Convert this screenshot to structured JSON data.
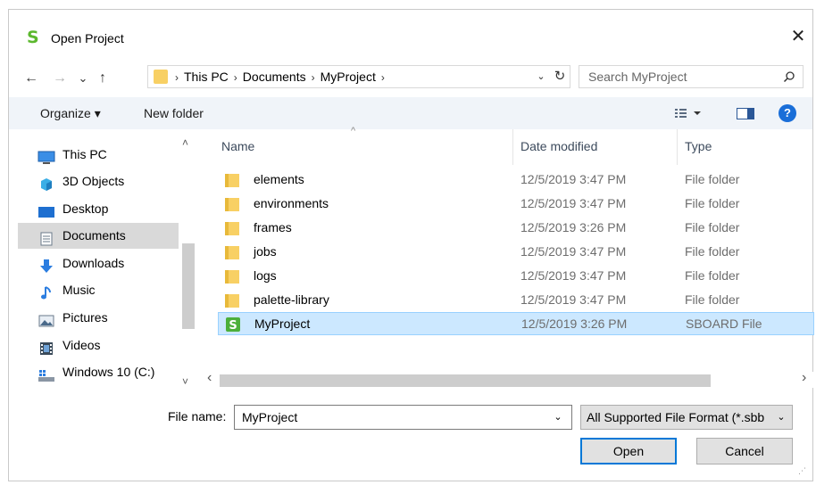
{
  "window": {
    "title": "Open Project",
    "close_glyph": "✕"
  },
  "nav_buttons": {
    "back": "←",
    "forward": "→",
    "recent": "⌄",
    "up": "↑"
  },
  "address": {
    "breadcrumbs": [
      "This PC",
      "Documents",
      "MyProject"
    ],
    "separator": "›",
    "dropdown_glyph": "⌄",
    "refresh_glyph": "↻"
  },
  "search": {
    "placeholder": "Search MyProject",
    "icon_glyph": "⚲"
  },
  "toolbar": {
    "organize_label": "Organize ▾",
    "new_folder_label": "New folder",
    "help_label": "?"
  },
  "nav_pane": {
    "items": [
      {
        "label": "This PC",
        "icon": "computer-icon"
      },
      {
        "label": "3D Objects",
        "icon": "3d-objects-icon"
      },
      {
        "label": "Desktop",
        "icon": "desktop-icon"
      },
      {
        "label": "Documents",
        "icon": "documents-icon",
        "selected": true
      },
      {
        "label": "Downloads",
        "icon": "download-arrow-icon"
      },
      {
        "label": "Music",
        "icon": "music-note-icon"
      },
      {
        "label": "Pictures",
        "icon": "pictures-icon"
      },
      {
        "label": "Videos",
        "icon": "film-icon"
      },
      {
        "label": "Windows 10 (C:)",
        "icon": "drive-icon"
      }
    ]
  },
  "columns": {
    "name": "Name",
    "date": "Date modified",
    "type": "Type"
  },
  "files": [
    {
      "name": "elements",
      "date": "12/5/2019 3:47 PM",
      "type": "File folder",
      "icon": "folder-icon"
    },
    {
      "name": "environments",
      "date": "12/5/2019 3:47 PM",
      "type": "File folder",
      "icon": "folder-icon"
    },
    {
      "name": "frames",
      "date": "12/5/2019 3:26 PM",
      "type": "File folder",
      "icon": "folder-icon"
    },
    {
      "name": "jobs",
      "date": "12/5/2019 3:47 PM",
      "type": "File folder",
      "icon": "folder-icon"
    },
    {
      "name": "logs",
      "date": "12/5/2019 3:47 PM",
      "type": "File folder",
      "icon": "folder-icon"
    },
    {
      "name": "palette-library",
      "date": "12/5/2019 3:47 PM",
      "type": "File folder",
      "icon": "folder-icon"
    },
    {
      "name": "MyProject",
      "date": "12/5/2019 3:26 PM",
      "type": "SBOARD File",
      "icon": "sboard-file-icon",
      "selected": true
    }
  ],
  "scroll": {
    "left_arrow": "‹",
    "right_arrow": "›",
    "up_arrow": "˄",
    "down_arrow": "˅"
  },
  "bottom": {
    "file_name_label": "File name:",
    "file_name_value": "MyProject",
    "filter_value": "All Supported File Format (*.sbb",
    "open_label": "Open",
    "cancel_label": "Cancel",
    "dropdown_glyph": "⌄"
  },
  "colors": {
    "toolbar_bg": "#f0f4f9",
    "selection_bg": "#cce8ff",
    "folder_yellow": "#f8d064",
    "accent_blue": "#0078d7",
    "sboard_green": "#5cb82e"
  }
}
